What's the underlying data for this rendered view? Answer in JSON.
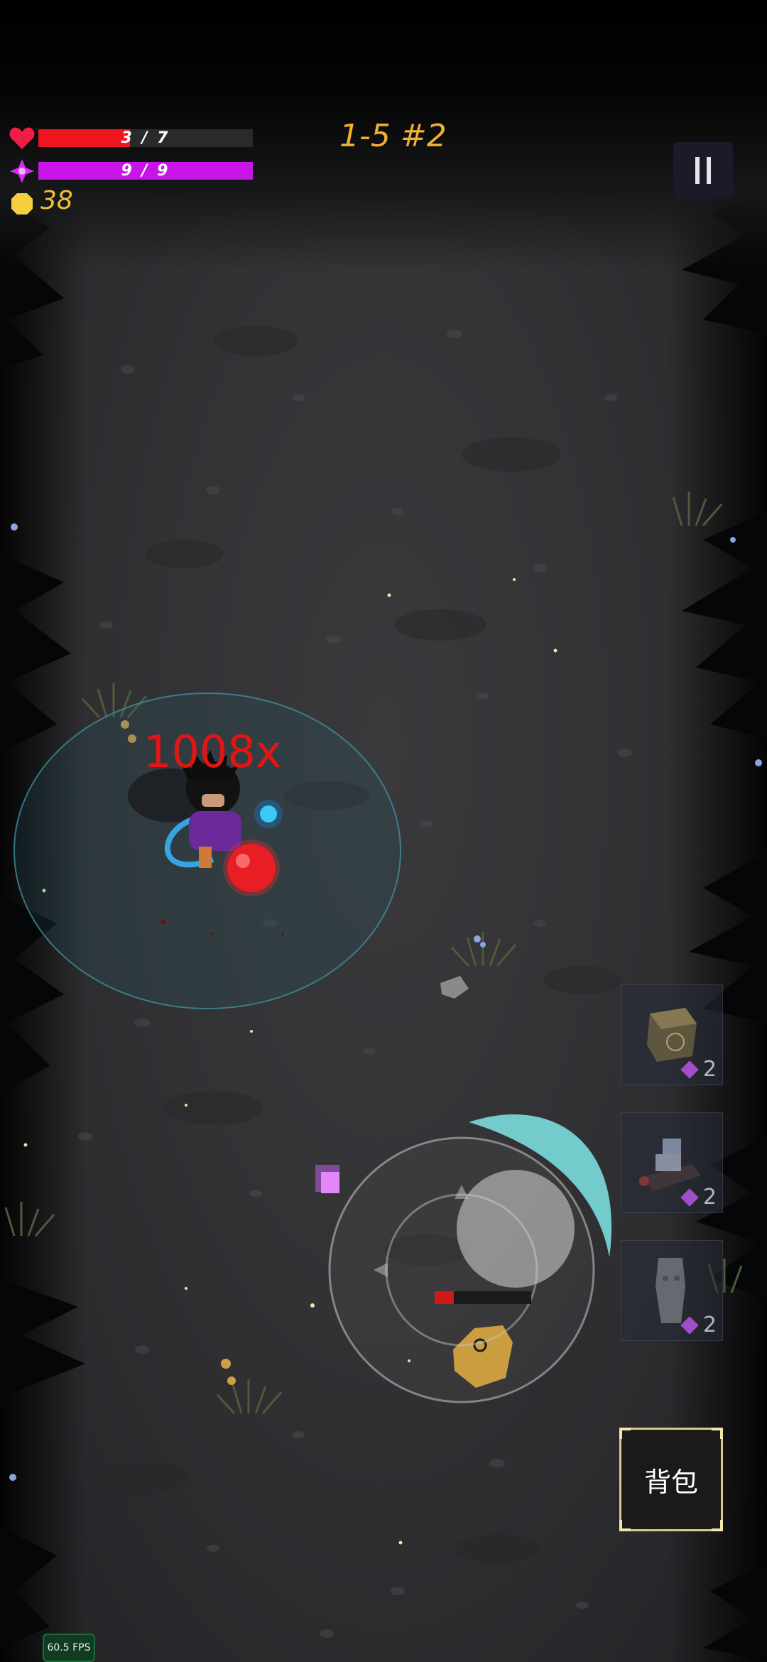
{
  "hud": {
    "health_text": "3 / 7",
    "health_fraction": 0.4286,
    "health_color": "#f0141e",
    "mana_text": "9 / 9",
    "mana_fraction": 1.0,
    "mana_color": "#c814e6",
    "gold_amount": "38",
    "gold_color": "#f0c232",
    "level_label": "1-5 #2",
    "level_color": "#f0b030",
    "icons": {
      "health": "heart-icon",
      "mana": "mana-crystal-icon",
      "gold": "gold-coin-icon",
      "pause": "pause-icon"
    }
  },
  "combat": {
    "damage_popup": "1008x",
    "damage_color": "#e31414",
    "enemy_health_fraction": 0.2
  },
  "skills": [
    {
      "name": "rune-box-skill",
      "cost": "2",
      "cost_icon": "mana-gem-icon"
    },
    {
      "name": "anvil-skill",
      "cost": "2",
      "cost_icon": "mana-gem-icon"
    },
    {
      "name": "stone-statue-skill",
      "cost": "2",
      "cost_icon": "mana-gem-icon"
    }
  ],
  "backpack": {
    "label": "背包"
  },
  "debug": {
    "fps_label": "60.5 FPS"
  }
}
